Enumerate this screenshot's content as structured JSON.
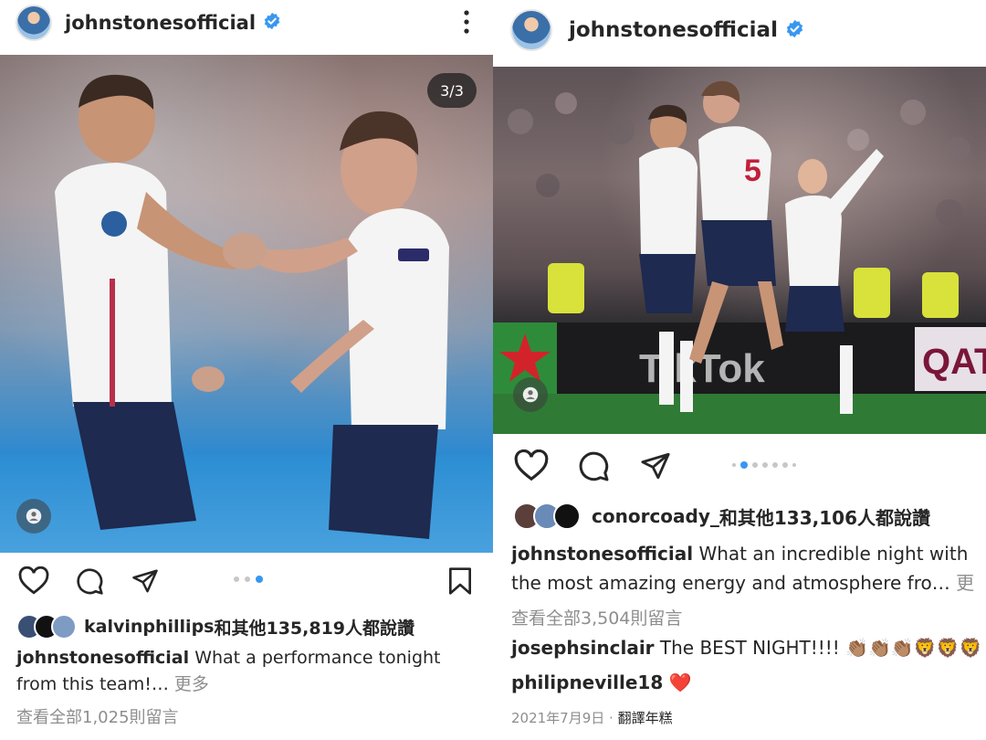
{
  "left_post": {
    "username": "johnstonesofficial",
    "carousel_counter": "3/3",
    "likes_user": "kalvinphillips",
    "likes_text": "和其他135,819人都說讚",
    "caption_user": "johnstonesofficial",
    "caption_text": "What a performance tonight from this team!…",
    "more_label": "更多",
    "view_comments": "查看全部1,025則留言"
  },
  "right_post": {
    "username": "johnstonesofficial",
    "likes_user": "conorcoady_",
    "likes_text": "和其他133,106人都說讚",
    "caption_user": "johnstonesofficial",
    "caption_text": "What an incredible night with the most amazing energy and atmosphere fro…",
    "more_label": "更多",
    "view_comments": "查看全部3,504則留言",
    "comments": [
      {
        "user": "josephsinclair",
        "text": "The BEST NIGHT!!!! 👏🏽👏🏽👏🏽🦁🦁🦁"
      },
      {
        "user": "philipneville18",
        "text": "❤️"
      }
    ],
    "date": "2021年7月9日",
    "translate_label": "翻譯年糕"
  },
  "colors": {
    "verified": "#3897f0",
    "active_dot": "#3897f0",
    "muted_text": "#8e8e8e"
  }
}
